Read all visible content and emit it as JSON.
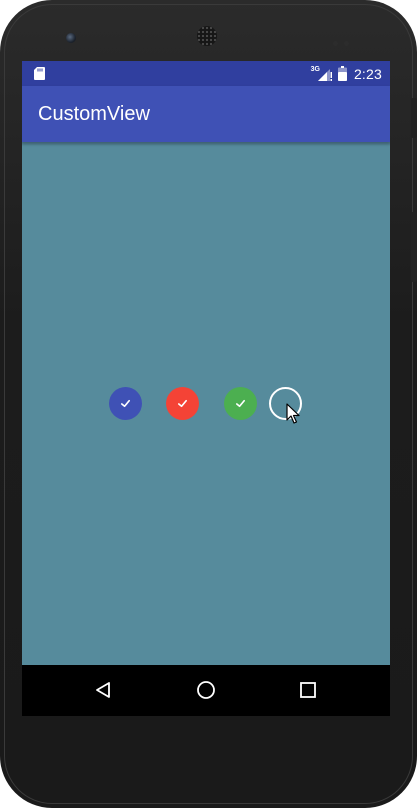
{
  "device": {
    "frame_color": "#1c1c1c"
  },
  "statusbar": {
    "background": "#303f9f",
    "left_icon": "sd-card-icon",
    "network_label": "3G",
    "signal_icon": "signal-icon",
    "battery_icon": "battery-icon",
    "time": "2:23"
  },
  "appbar": {
    "background": "#3f51b5",
    "title": "CustomView"
  },
  "content": {
    "background": "#568b9c",
    "check_items": [
      {
        "name": "check-circle-blue",
        "color": "#3f51b5",
        "checked": true,
        "icon": "check-icon"
      },
      {
        "name": "check-circle-red",
        "color": "#f44336",
        "checked": true,
        "icon": "check-icon"
      },
      {
        "name": "check-circle-green",
        "color": "#4caf50",
        "checked": true,
        "icon": "check-icon"
      },
      {
        "name": "check-circle-empty",
        "color": "#ffffff",
        "checked": false,
        "icon": ""
      }
    ]
  },
  "navbar": {
    "background": "#000000",
    "buttons": [
      {
        "name": "back-button",
        "icon": "back-triangle-icon"
      },
      {
        "name": "home-button",
        "icon": "home-circle-icon"
      },
      {
        "name": "recents-button",
        "icon": "recents-square-icon"
      }
    ]
  }
}
